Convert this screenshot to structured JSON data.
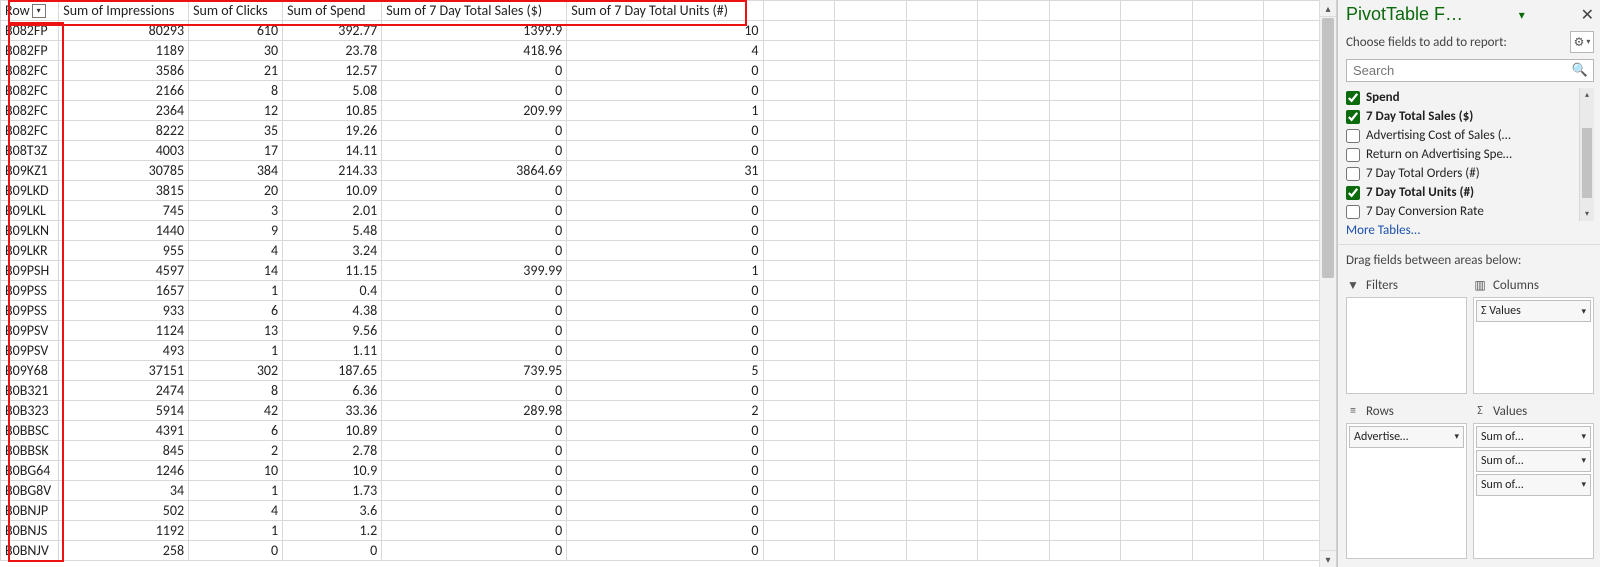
{
  "headers": {
    "row": "Row",
    "c1": "Sum of Impressions",
    "c2": "Sum of Clicks",
    "c3": "Sum of Spend",
    "c4": "Sum of 7 Day Total Sales ($)",
    "c5": "Sum of 7 Day Total Units (#)"
  },
  "rows": [
    {
      "label": "B082FP",
      "impr": "80293",
      "clicks": "610",
      "spend": "392.77",
      "sales": "1399.9",
      "units": "10"
    },
    {
      "label": "B082FP",
      "impr": "1189",
      "clicks": "30",
      "spend": "23.78",
      "sales": "418.96",
      "units": "4"
    },
    {
      "label": "B082FC",
      "impr": "3586",
      "clicks": "21",
      "spend": "12.57",
      "sales": "0",
      "units": "0"
    },
    {
      "label": "B082FC",
      "impr": "2166",
      "clicks": "8",
      "spend": "5.08",
      "sales": "0",
      "units": "0"
    },
    {
      "label": "B082FC",
      "impr": "2364",
      "clicks": "12",
      "spend": "10.85",
      "sales": "209.99",
      "units": "1"
    },
    {
      "label": "B082FC",
      "impr": "8222",
      "clicks": "35",
      "spend": "19.26",
      "sales": "0",
      "units": "0"
    },
    {
      "label": "B08T3Z",
      "impr": "4003",
      "clicks": "17",
      "spend": "14.11",
      "sales": "0",
      "units": "0"
    },
    {
      "label": "B09KZ1",
      "impr": "30785",
      "clicks": "384",
      "spend": "214.33",
      "sales": "3864.69",
      "units": "31"
    },
    {
      "label": "B09LKD",
      "impr": "3815",
      "clicks": "20",
      "spend": "10.09",
      "sales": "0",
      "units": "0"
    },
    {
      "label": "B09LKL",
      "impr": "745",
      "clicks": "3",
      "spend": "2.01",
      "sales": "0",
      "units": "0"
    },
    {
      "label": "B09LKN",
      "impr": "1440",
      "clicks": "9",
      "spend": "5.48",
      "sales": "0",
      "units": "0"
    },
    {
      "label": "B09LKR",
      "impr": "955",
      "clicks": "4",
      "spend": "3.24",
      "sales": "0",
      "units": "0"
    },
    {
      "label": "B09PSH",
      "impr": "4597",
      "clicks": "14",
      "spend": "11.15",
      "sales": "399.99",
      "units": "1"
    },
    {
      "label": "B09PSS",
      "impr": "1657",
      "clicks": "1",
      "spend": "0.4",
      "sales": "0",
      "units": "0"
    },
    {
      "label": "B09PSS",
      "impr": "933",
      "clicks": "6",
      "spend": "4.38",
      "sales": "0",
      "units": "0"
    },
    {
      "label": "B09PSV",
      "impr": "1124",
      "clicks": "13",
      "spend": "9.56",
      "sales": "0",
      "units": "0"
    },
    {
      "label": "B09PSV",
      "impr": "493",
      "clicks": "1",
      "spend": "1.11",
      "sales": "0",
      "units": "0"
    },
    {
      "label": "B09Y68",
      "impr": "37151",
      "clicks": "302",
      "spend": "187.65",
      "sales": "739.95",
      "units": "5"
    },
    {
      "label": "B0B321",
      "impr": "2474",
      "clicks": "8",
      "spend": "6.36",
      "sales": "0",
      "units": "0"
    },
    {
      "label": "B0B323",
      "impr": "5914",
      "clicks": "42",
      "spend": "33.36",
      "sales": "289.98",
      "units": "2"
    },
    {
      "label": "B0BBSC",
      "impr": "4391",
      "clicks": "6",
      "spend": "10.89",
      "sales": "0",
      "units": "0"
    },
    {
      "label": "B0BBSK",
      "impr": "845",
      "clicks": "2",
      "spend": "2.78",
      "sales": "0",
      "units": "0"
    },
    {
      "label": "B0BG64",
      "impr": "1246",
      "clicks": "10",
      "spend": "10.9",
      "sales": "0",
      "units": "0"
    },
    {
      "label": "B0BG8V",
      "impr": "34",
      "clicks": "1",
      "spend": "1.73",
      "sales": "0",
      "units": "0"
    },
    {
      "label": "B0BNJP",
      "impr": "502",
      "clicks": "4",
      "spend": "3.6",
      "sales": "0",
      "units": "0"
    },
    {
      "label": "B0BNJS",
      "impr": "1192",
      "clicks": "1",
      "spend": "1.2",
      "sales": "0",
      "units": "0"
    },
    {
      "label": "B0BNJV",
      "impr": "258",
      "clicks": "0",
      "spend": "0",
      "sales": "0",
      "units": "0"
    }
  ],
  "panel": {
    "title": "PivotTable F…",
    "sub": "Choose fields to add to report:",
    "search_ph": "Search",
    "fields": [
      {
        "label": "Spend",
        "checked": true,
        "bold": true
      },
      {
        "label": "7 Day Total Sales ($)",
        "checked": true,
        "bold": true
      },
      {
        "label": "Advertising Cost of Sales (…",
        "checked": false,
        "bold": false
      },
      {
        "label": "Return on Advertising Spe…",
        "checked": false,
        "bold": false
      },
      {
        "label": "7 Day Total Orders (#)",
        "checked": false,
        "bold": false
      },
      {
        "label": "7 Day Total Units (#)",
        "checked": true,
        "bold": true
      },
      {
        "label": "7 Day Conversion Rate",
        "checked": false,
        "bold": false
      }
    ],
    "more_tables": "More Tables...",
    "drag_hint": "Drag fields between areas below:",
    "area_filters": "Filters",
    "area_columns": "Columns",
    "area_rows": "Rows",
    "area_values": "Values",
    "columns_pill": "Σ Values",
    "rows_pill": "Advertise…",
    "values_pill1": "Sum of…",
    "values_pill2": "Sum of…",
    "values_pill3": "Sum of…"
  }
}
